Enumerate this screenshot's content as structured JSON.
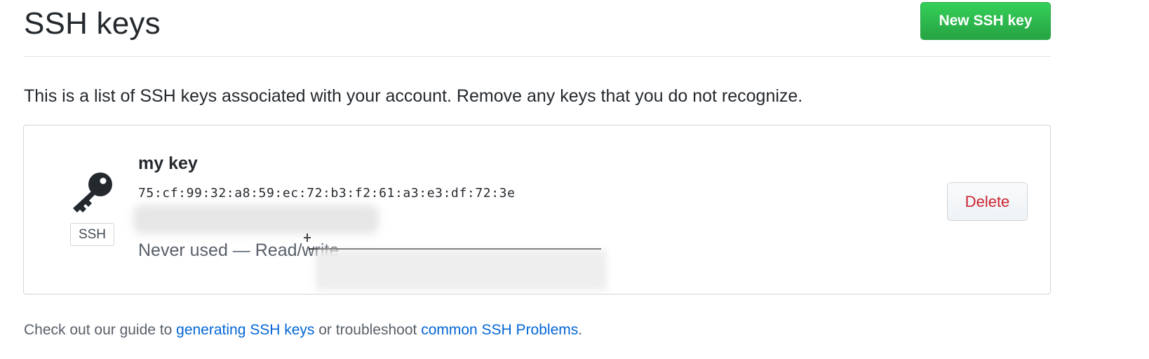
{
  "header": {
    "title": "SSH keys",
    "new_key_label": "New SSH key"
  },
  "intro": "This is a list of SSH keys associated with your account. Remove any keys that you do not recognize.",
  "key": {
    "name": "my key",
    "fingerprint": "75:cf:99:32:a8:59:ec:72:b3:f2:61:a3:e3:df:72:3e",
    "badge": "SSH",
    "usage": "Never used — Read/write",
    "icon": "key-icon",
    "delete_label": "Delete"
  },
  "footer": {
    "prefix": "Check out our guide to ",
    "link1": "generating SSH keys",
    "middle": " or troubleshoot ",
    "link2": "common SSH Problems",
    "suffix": "."
  },
  "colors": {
    "primary_button": "#28a745",
    "danger_text": "#cb2431",
    "link": "#0366d6"
  }
}
